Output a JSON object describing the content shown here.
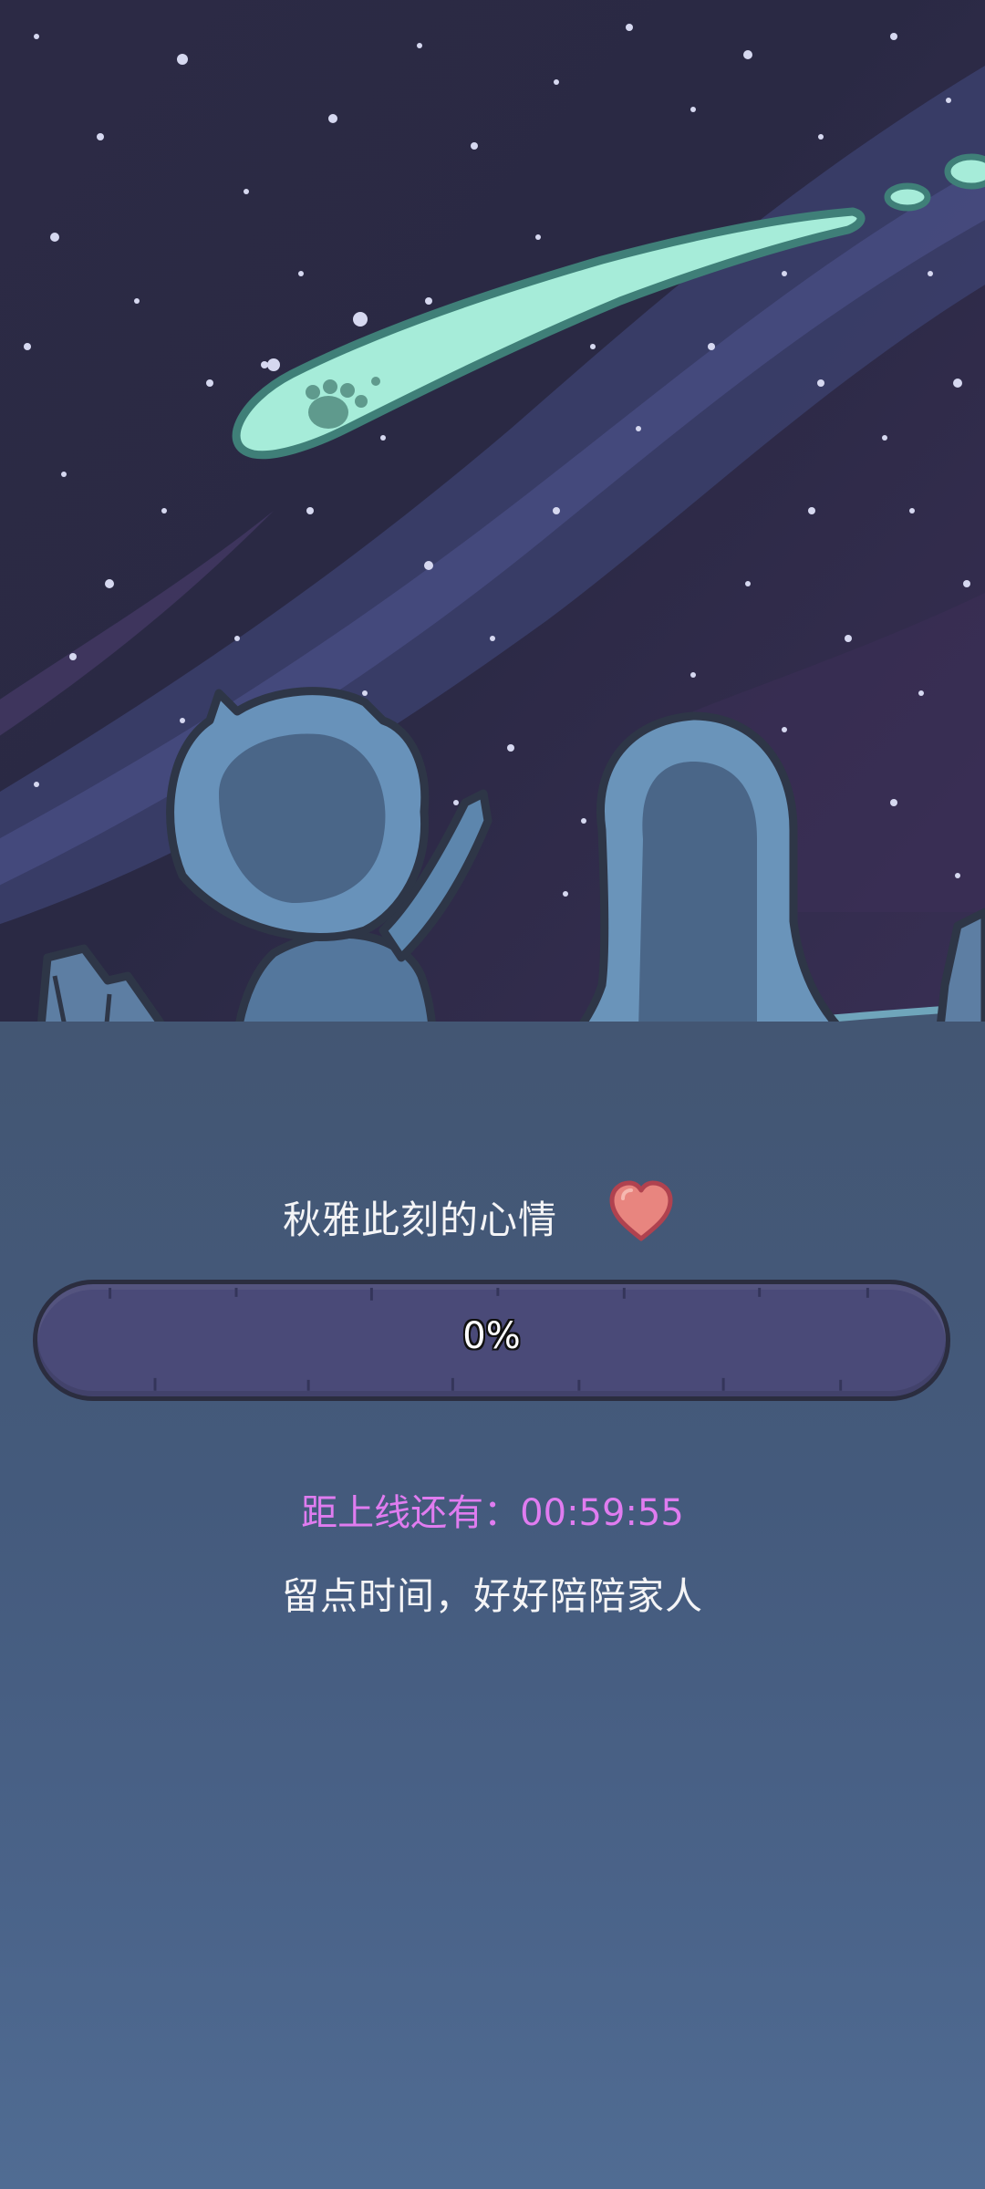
{
  "mood": {
    "label": "秋雅此刻的心情",
    "percent_label": "0%",
    "level": 0,
    "heart_icon": "heart-icon"
  },
  "status": {
    "countdown_label": "距上线还有：",
    "countdown_time": "00:59:55",
    "hint": "留点时间，好好陪陪家人"
  },
  "colors": {
    "sky_dark": "#262640",
    "meteor": "#a6ecd9",
    "characters": "#5a7ca0",
    "bar": "#4a4a78",
    "heart": "#e8857f",
    "countdown": "#e07cf0"
  }
}
